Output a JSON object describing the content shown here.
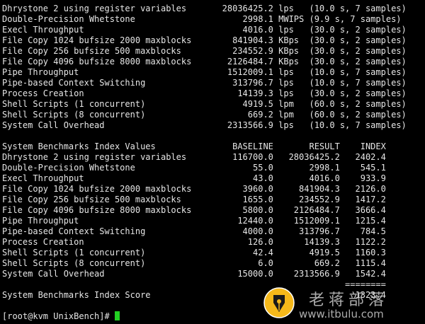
{
  "terminal": {
    "lines": [
      "Dhrystone 2 using register variables       28036425.2 lps   (10.0 s, 7 samples)",
      "Double-Precision Whetstone                     2998.1 MWIPS (9.9 s, 7 samples)",
      "Execl Throughput                               4016.0 lps   (30.0 s, 2 samples)",
      "File Copy 1024 bufsize 2000 maxblocks        841904.3 KBps  (30.0 s, 2 samples)",
      "File Copy 256 bufsize 500 maxblocks          234552.9 KBps  (30.0 s, 2 samples)",
      "File Copy 4096 bufsize 8000 maxblocks       2126484.7 KBps  (30.0 s, 2 samples)",
      "Pipe Throughput                             1512009.1 lps   (10.0 s, 7 samples)",
      "Pipe-based Context Switching                 313796.7 lps   (10.0 s, 7 samples)",
      "Process Creation                              14139.3 lps   (30.0 s, 2 samples)",
      "Shell Scripts (1 concurrent)                   4919.5 lpm   (60.0 s, 2 samples)",
      "Shell Scripts (8 concurrent)                    669.2 lpm   (60.0 s, 2 samples)",
      "System Call Overhead                        2313566.9 lps   (10.0 s, 7 samples)",
      "",
      "System Benchmarks Index Values               BASELINE       RESULT    INDEX",
      "Dhrystone 2 using register variables         116700.0   28036425.2   2402.4",
      "Double-Precision Whetstone                       55.0       2998.1    545.1",
      "Execl Throughput                                 43.0       4016.0    933.9",
      "File Copy 1024 bufsize 2000 maxblocks          3960.0     841904.3   2126.0",
      "File Copy 256 bufsize 500 maxblocks            1655.0     234552.9   1417.2",
      "File Copy 4096 bufsize 8000 maxblocks          5800.0    2126484.7   3666.4",
      "Pipe Throughput                               12440.0    1512009.1   1215.4",
      "Pipe-based Context Switching                   4000.0     313796.7    784.5",
      "Process Creation                                126.0      14139.3   1122.2",
      "Shell Scripts (1 concurrent)                     42.4       4919.5   1160.3",
      "Shell Scripts (8 concurrent)                      6.0        669.2   1115.4",
      "System Call Overhead                          15000.0    2313566.9   1542.4",
      "                                                                   ========",
      "System Benchmarks Index Score                                        1323.4",
      ""
    ],
    "prompt": "[root@kvm UnixBench]# ",
    "cursor_color": "#22d022"
  },
  "watermark": {
    "title": "老蒋部落",
    "url": "www.itbulu.com",
    "logo_icon": "pen-nib-icon",
    "logo_color": "#f5b81a"
  }
}
